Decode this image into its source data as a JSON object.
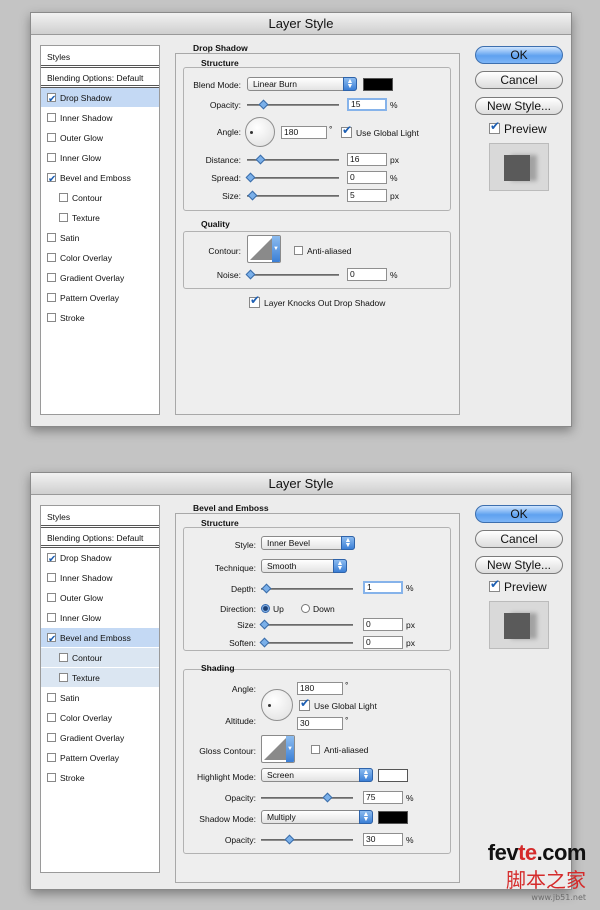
{
  "dialog1": {
    "title": "Layer Style",
    "styles_header": "Styles",
    "blending": "Blending Options: Default",
    "items": [
      {
        "label": "Drop Shadow",
        "checked": true
      },
      {
        "label": "Inner Shadow",
        "checked": false
      },
      {
        "label": "Outer Glow",
        "checked": false
      },
      {
        "label": "Inner Glow",
        "checked": false
      },
      {
        "label": "Bevel and Emboss",
        "checked": true
      },
      {
        "label": "Contour",
        "checked": false
      },
      {
        "label": "Texture",
        "checked": false
      },
      {
        "label": "Satin",
        "checked": false
      },
      {
        "label": "Color Overlay",
        "checked": false
      },
      {
        "label": "Gradient Overlay",
        "checked": false
      },
      {
        "label": "Pattern Overlay",
        "checked": false
      },
      {
        "label": "Stroke",
        "checked": false
      }
    ],
    "panel_title": "Drop Shadow",
    "structure_title": "Structure",
    "blend_mode_label": "Blend Mode:",
    "blend_mode_value": "Linear Burn",
    "shadow_color": "#000000",
    "opacity_label": "Opacity:",
    "opacity_value": "15",
    "angle_label": "Angle:",
    "angle_value": "180",
    "use_global_light": "Use Global Light",
    "distance_label": "Distance:",
    "distance_value": "16",
    "spread_label": "Spread:",
    "spread_value": "0",
    "size_label": "Size:",
    "size_value": "5",
    "quality_title": "Quality",
    "contour_label": "Contour:",
    "anti_aliased": "Anti-aliased",
    "noise_label": "Noise:",
    "noise_value": "0",
    "knockout": "Layer Knocks Out Drop Shadow",
    "unit_percent": "%",
    "unit_px": "px",
    "unit_degree": "°",
    "ok": "OK",
    "cancel": "Cancel",
    "new_style": "New Style...",
    "preview": "Preview"
  },
  "dialog2": {
    "title": "Layer Style",
    "styles_header": "Styles",
    "blending": "Blending Options: Default",
    "items": [
      {
        "label": "Drop Shadow",
        "checked": true
      },
      {
        "label": "Inner Shadow",
        "checked": false
      },
      {
        "label": "Outer Glow",
        "checked": false
      },
      {
        "label": "Inner Glow",
        "checked": false
      },
      {
        "label": "Bevel and Emboss",
        "checked": true
      },
      {
        "label": "Contour",
        "checked": false
      },
      {
        "label": "Texture",
        "checked": false
      },
      {
        "label": "Satin",
        "checked": false
      },
      {
        "label": "Color Overlay",
        "checked": false
      },
      {
        "label": "Gradient Overlay",
        "checked": false
      },
      {
        "label": "Pattern Overlay",
        "checked": false
      },
      {
        "label": "Stroke",
        "checked": false
      }
    ],
    "panel_title": "Bevel and Emboss",
    "structure_title": "Structure",
    "style_label": "Style:",
    "style_value": "Inner Bevel",
    "technique_label": "Technique:",
    "technique_value": "Smooth",
    "depth_label": "Depth:",
    "depth_value": "1",
    "direction_label": "Direction:",
    "dir_up": "Up",
    "dir_down": "Down",
    "size_label": "Size:",
    "size_value": "0",
    "soften_label": "Soften:",
    "soften_value": "0",
    "shading_title": "Shading",
    "angle_label": "Angle:",
    "angle_value": "180",
    "use_global_light": "Use Global Light",
    "altitude_label": "Altitude:",
    "altitude_value": "30",
    "gloss_label": "Gloss Contour:",
    "anti_aliased": "Anti-aliased",
    "highlight_mode_label": "Highlight Mode:",
    "highlight_mode_value": "Screen",
    "highlight_color": "#ffffff",
    "hl_opacity_label": "Opacity:",
    "hl_opacity_value": "75",
    "shadow_mode_label": "Shadow Mode:",
    "shadow_mode_value": "Multiply",
    "shadow_color": "#000000",
    "sh_opacity_label": "Opacity:",
    "sh_opacity_value": "30",
    "unit_percent": "%",
    "unit_px": "px",
    "unit_degree": "°",
    "ok": "OK",
    "cancel": "Cancel",
    "new_style": "New Style...",
    "preview": "Preview"
  },
  "sliders": {
    "d1_opacity": 0.15,
    "d1_distance": 0.12,
    "d1_spread": 0.0,
    "d1_size": 0.02,
    "d1_noise": 0.0,
    "d2_depth": 0.02,
    "d2_size": 0.0,
    "d2_soften": 0.0,
    "d2_hl_opacity": 0.75,
    "d2_sh_opacity": 0.3
  },
  "watermark": {
    "brand_a": "fev",
    "brand_b": "te",
    "brand_c": ".com",
    "chinese": "脚本之家",
    "url": "www.jb51.net"
  }
}
